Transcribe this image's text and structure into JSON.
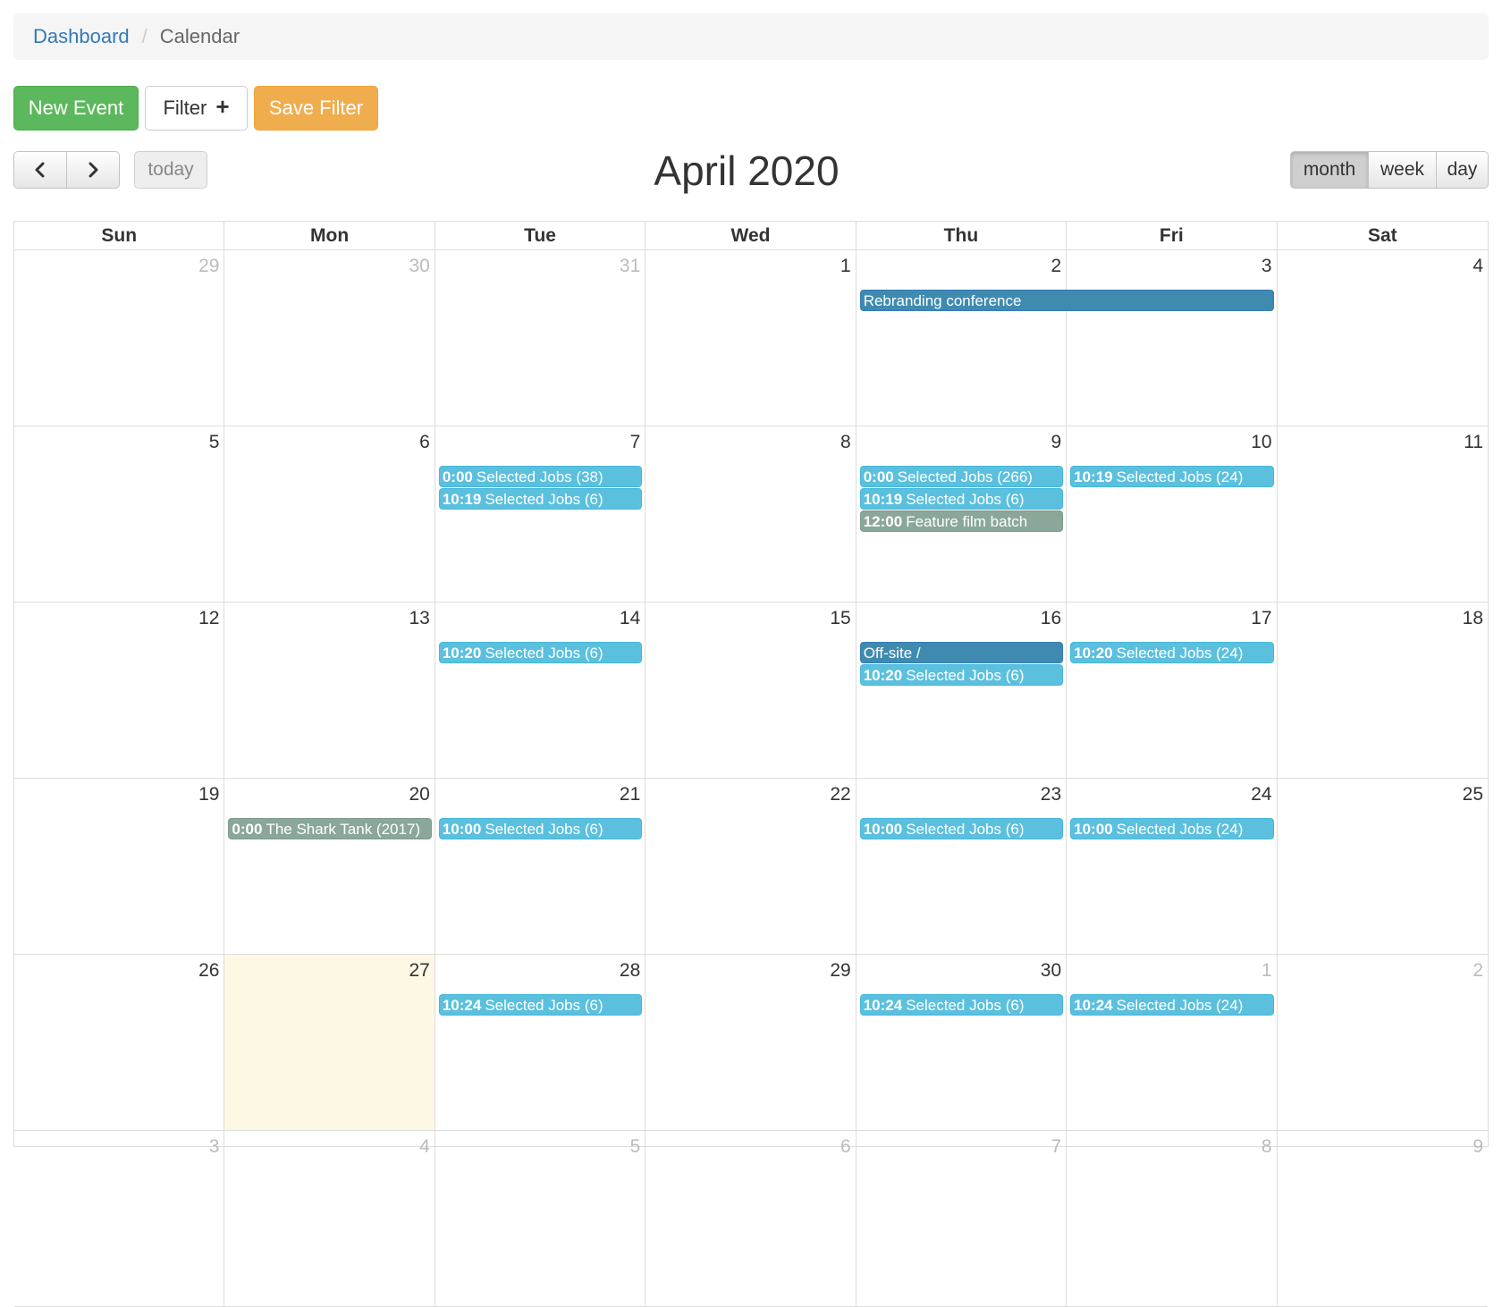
{
  "breadcrumb": {
    "link": "Dashboard",
    "separator": "/",
    "current": "Calendar"
  },
  "actions": {
    "new_event": "New Event",
    "filter": "Filter",
    "filter_icon": "plus-icon",
    "save_filter": "Save Filter"
  },
  "nav": {
    "prev_icon": "chevron-left-icon",
    "next_icon": "chevron-right-icon",
    "prev": "‹",
    "next": "›",
    "today": "today"
  },
  "title": "April 2020",
  "views": {
    "month": "month",
    "week": "week",
    "day": "day",
    "active": "month"
  },
  "weekdays": [
    "Sun",
    "Mon",
    "Tue",
    "Wed",
    "Thu",
    "Fri",
    "Sat"
  ],
  "colors": {
    "light_event": "#5bc0de",
    "dark_event": "#3f8bb0",
    "grey_event": "#8aa79a",
    "today_bg": "#fcf8e3",
    "new_button": "#5cb85c",
    "save_button": "#f0ad4e"
  },
  "weeks": [
    {
      "days": [
        {
          "n": "29",
          "other": true
        },
        {
          "n": "30",
          "other": true
        },
        {
          "n": "31",
          "other": true
        },
        {
          "n": "1"
        },
        {
          "n": "2"
        },
        {
          "n": "3"
        },
        {
          "n": "4"
        }
      ],
      "events": [
        {
          "start": 4,
          "span": 2,
          "row": 0,
          "time": "",
          "title": "Rebranding conference",
          "style": "dark"
        }
      ]
    },
    {
      "days": [
        {
          "n": "5"
        },
        {
          "n": "6"
        },
        {
          "n": "7"
        },
        {
          "n": "8"
        },
        {
          "n": "9"
        },
        {
          "n": "10"
        },
        {
          "n": "11"
        }
      ],
      "events": [
        {
          "start": 2,
          "span": 1,
          "row": 0,
          "time": "0:00",
          "title": "Selected Jobs (38)",
          "style": "light"
        },
        {
          "start": 2,
          "span": 1,
          "row": 1,
          "time": "10:19",
          "title": "Selected Jobs (6)",
          "style": "light"
        },
        {
          "start": 4,
          "span": 1,
          "row": 0,
          "time": "0:00",
          "title": "Selected Jobs (266)",
          "style": "light"
        },
        {
          "start": 4,
          "span": 1,
          "row": 1,
          "time": "10:19",
          "title": "Selected Jobs (6)",
          "style": "light"
        },
        {
          "start": 4,
          "span": 1,
          "row": 2,
          "time": "12:00",
          "title": "Feature film batch",
          "style": "grey"
        },
        {
          "start": 5,
          "span": 1,
          "row": 0,
          "time": "10:19",
          "title": "Selected Jobs (24)",
          "style": "light"
        }
      ]
    },
    {
      "days": [
        {
          "n": "12"
        },
        {
          "n": "13"
        },
        {
          "n": "14"
        },
        {
          "n": "15"
        },
        {
          "n": "16"
        },
        {
          "n": "17"
        },
        {
          "n": "18"
        }
      ],
      "events": [
        {
          "start": 2,
          "span": 1,
          "row": 0,
          "time": "10:20",
          "title": "Selected Jobs (6)",
          "style": "light"
        },
        {
          "start": 4,
          "span": 1,
          "row": 0,
          "time": "",
          "title": "Off-site /",
          "style": "dark"
        },
        {
          "start": 4,
          "span": 1,
          "row": 1,
          "time": "10:20",
          "title": "Selected Jobs (6)",
          "style": "light"
        },
        {
          "start": 5,
          "span": 1,
          "row": 0,
          "time": "10:20",
          "title": "Selected Jobs (24)",
          "style": "light"
        }
      ]
    },
    {
      "days": [
        {
          "n": "19"
        },
        {
          "n": "20"
        },
        {
          "n": "21"
        },
        {
          "n": "22"
        },
        {
          "n": "23"
        },
        {
          "n": "24"
        },
        {
          "n": "25"
        }
      ],
      "events": [
        {
          "start": 1,
          "span": 1,
          "row": 0,
          "time": "0:00",
          "title": "The Shark Tank (2017)",
          "style": "grey"
        },
        {
          "start": 2,
          "span": 1,
          "row": 0,
          "time": "10:00",
          "title": "Selected Jobs (6)",
          "style": "light"
        },
        {
          "start": 4,
          "span": 1,
          "row": 0,
          "time": "10:00",
          "title": "Selected Jobs (6)",
          "style": "light"
        },
        {
          "start": 5,
          "span": 1,
          "row": 0,
          "time": "10:00",
          "title": "Selected Jobs (24)",
          "style": "light"
        }
      ]
    },
    {
      "days": [
        {
          "n": "26"
        },
        {
          "n": "27",
          "today": true
        },
        {
          "n": "28"
        },
        {
          "n": "29"
        },
        {
          "n": "30"
        },
        {
          "n": "1",
          "other": true
        },
        {
          "n": "2",
          "other": true
        }
      ],
      "events": [
        {
          "start": 2,
          "span": 1,
          "row": 0,
          "time": "10:24",
          "title": "Selected Jobs (6)",
          "style": "light"
        },
        {
          "start": 4,
          "span": 1,
          "row": 0,
          "time": "10:24",
          "title": "Selected Jobs (6)",
          "style": "light"
        },
        {
          "start": 5,
          "span": 1,
          "row": 0,
          "time": "10:24",
          "title": "Selected Jobs (24)",
          "style": "light"
        }
      ]
    },
    {
      "days": [
        {
          "n": "3",
          "other": true
        },
        {
          "n": "4",
          "other": true
        },
        {
          "n": "5",
          "other": true
        },
        {
          "n": "6",
          "other": true
        },
        {
          "n": "7",
          "other": true
        },
        {
          "n": "8",
          "other": true
        },
        {
          "n": "9",
          "other": true
        }
      ],
      "events": []
    }
  ]
}
